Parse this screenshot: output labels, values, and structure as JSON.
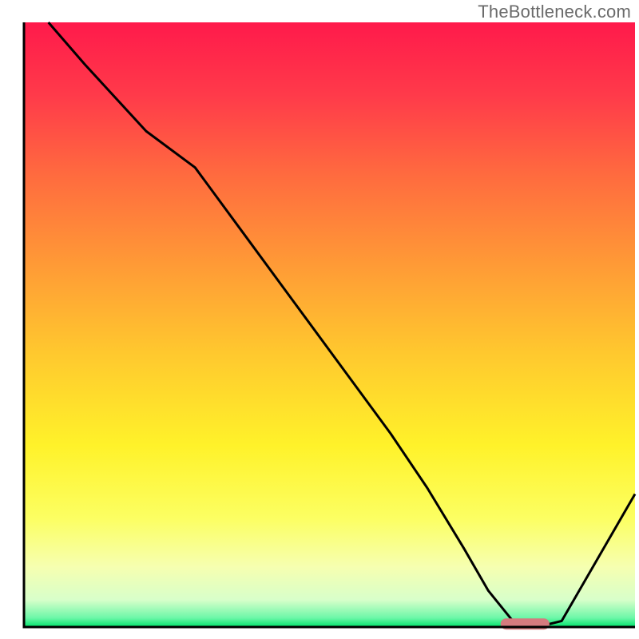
{
  "watermark": "TheBottleneck.com",
  "chart_data": {
    "type": "line",
    "title": "",
    "xlabel": "",
    "ylabel": "",
    "xlim": [
      0,
      100
    ],
    "ylim": [
      0,
      100
    ],
    "series": [
      {
        "name": "curve",
        "x": [
          4,
          10,
          20,
          28,
          36,
          44,
          52,
          60,
          66,
          72,
          76,
          80,
          84,
          88,
          100
        ],
        "y": [
          100,
          93,
          82,
          76,
          65,
          54,
          43,
          32,
          23,
          13,
          6,
          1,
          0,
          1,
          22
        ]
      }
    ],
    "marker": {
      "name": "optimal-range",
      "x_start": 78,
      "x_end": 86,
      "y": 0.5,
      "color": "#d57b7f"
    },
    "background_gradient": {
      "stops": [
        {
          "offset": 0.0,
          "color": "#ff1a4b"
        },
        {
          "offset": 0.12,
          "color": "#ff3a4a"
        },
        {
          "offset": 0.25,
          "color": "#ff6a3f"
        },
        {
          "offset": 0.4,
          "color": "#ff9a36"
        },
        {
          "offset": 0.55,
          "color": "#ffc92e"
        },
        {
          "offset": 0.7,
          "color": "#fff22a"
        },
        {
          "offset": 0.82,
          "color": "#fcff62"
        },
        {
          "offset": 0.9,
          "color": "#f6ffb0"
        },
        {
          "offset": 0.955,
          "color": "#d8ffca"
        },
        {
          "offset": 0.985,
          "color": "#6cf7a8"
        },
        {
          "offset": 1.0,
          "color": "#00e36b"
        }
      ]
    },
    "axes": {
      "color": "#000000",
      "width": 3
    }
  }
}
